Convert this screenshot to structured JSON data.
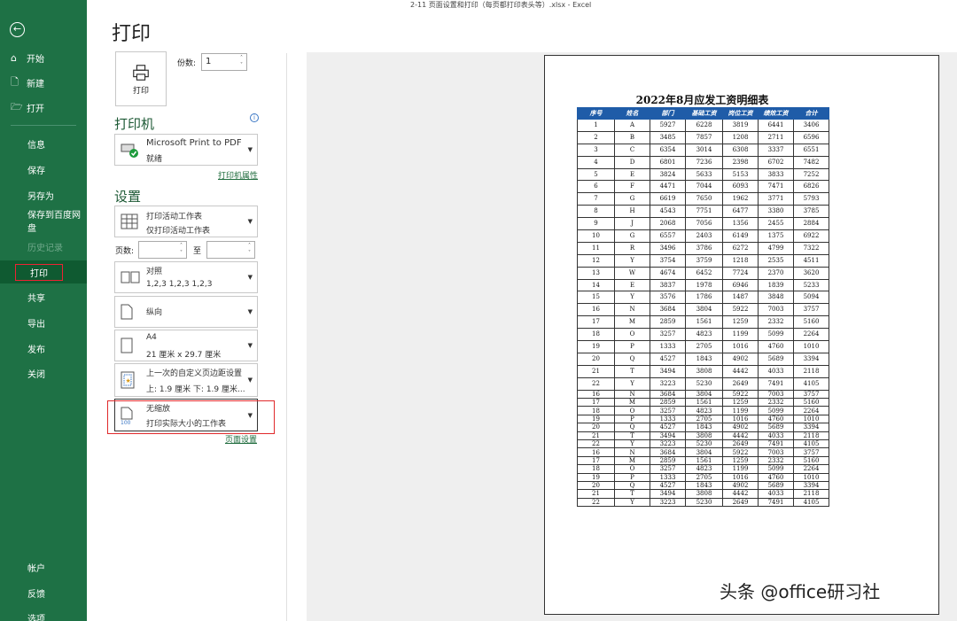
{
  "window_title": "2-11 页面设置和打印（每页都打印表头等）.xlsx  -  Excel",
  "page_title": "打印",
  "sidebar": {
    "top": [
      {
        "label": "开始",
        "icon": "⌂"
      },
      {
        "label": "新建",
        "icon": "🗋"
      },
      {
        "label": "打开",
        "icon": "🗁"
      }
    ],
    "main": [
      {
        "label": "信息"
      },
      {
        "label": "保存"
      },
      {
        "label": "另存为"
      },
      {
        "label": "保存到百度网盘"
      },
      {
        "label": "历史记录"
      },
      {
        "label": "打印"
      },
      {
        "label": "共享"
      },
      {
        "label": "导出"
      },
      {
        "label": "发布"
      },
      {
        "label": "关闭"
      }
    ],
    "bottom": [
      {
        "label": "帐户"
      },
      {
        "label": "反馈"
      },
      {
        "label": "选项"
      }
    ]
  },
  "print": {
    "button_label": "打印",
    "copies_label": "份数:",
    "copies_value": "1",
    "printer_heading": "打印机",
    "printer_name": "Microsoft Print to PDF",
    "printer_status": "就绪",
    "printer_props_link": "打印机属性",
    "settings_heading": "设置",
    "scope_line1": "打印活动工作表",
    "scope_line2": "仅打印活动工作表",
    "pages_label": "页数:",
    "pages_to": "至",
    "collate_line1": "对照",
    "collate_line2": "1,2,3    1,2,3    1,2,3",
    "orientation": "纵向",
    "paper_line1": "A4",
    "paper_line2": "21 厘米 x 29.7 厘米",
    "margins_line1": "上一次的自定义页边距设置",
    "margins_line2": "上: 1.9 厘米 下: 1.9 厘米...",
    "scaling_line1": "无缩放",
    "scaling_line2": "打印实际大小的工作表",
    "page_setup_link": "页面设置"
  },
  "sheet": {
    "title": "2022年8月应发工资明细表",
    "headers": [
      "序号",
      "姓名",
      "部门",
      "基础工资",
      "岗位工资",
      "绩效工资",
      "合计"
    ],
    "rows": [
      [
        "1",
        "A",
        "5927",
        "6228",
        "3819",
        "6441",
        "3406"
      ],
      [
        "2",
        "B",
        "3485",
        "7857",
        "1208",
        "2711",
        "6596"
      ],
      [
        "3",
        "C",
        "6354",
        "3014",
        "6308",
        "3337",
        "6551"
      ],
      [
        "4",
        "D",
        "6801",
        "7236",
        "2398",
        "6702",
        "7482"
      ],
      [
        "5",
        "E",
        "3824",
        "5633",
        "5153",
        "3833",
        "7252"
      ],
      [
        "6",
        "F",
        "4471",
        "7044",
        "6093",
        "7471",
        "6826"
      ],
      [
        "7",
        "G",
        "6619",
        "7650",
        "1962",
        "3771",
        "5793"
      ],
      [
        "8",
        "H",
        "4543",
        "7751",
        "6477",
        "3380",
        "3785"
      ],
      [
        "9",
        "J",
        "2068",
        "7056",
        "1356",
        "2455",
        "2884"
      ],
      [
        "10",
        "G",
        "6557",
        "2403",
        "6149",
        "1375",
        "6922"
      ],
      [
        "11",
        "R",
        "3496",
        "3786",
        "6272",
        "4799",
        "7322"
      ],
      [
        "12",
        "Y",
        "3754",
        "3759",
        "1218",
        "2535",
        "4511"
      ],
      [
        "13",
        "W",
        "4674",
        "6452",
        "7724",
        "2370",
        "3620"
      ],
      [
        "14",
        "E",
        "3837",
        "1978",
        "6946",
        "1839",
        "5233"
      ],
      [
        "15",
        "Y",
        "3576",
        "1786",
        "1487",
        "3848",
        "5094"
      ],
      [
        "16",
        "N",
        "3684",
        "3804",
        "5922",
        "7003",
        "3757"
      ],
      [
        "17",
        "M",
        "2859",
        "1561",
        "1259",
        "2332",
        "5160"
      ],
      [
        "18",
        "O",
        "3257",
        "4823",
        "1199",
        "5099",
        "2264"
      ],
      [
        "19",
        "P",
        "1333",
        "2705",
        "1016",
        "4760",
        "1010"
      ],
      [
        "20",
        "Q",
        "4527",
        "1843",
        "4902",
        "5689",
        "3394"
      ],
      [
        "21",
        "T",
        "3494",
        "3808",
        "4442",
        "4033",
        "2118"
      ],
      [
        "22",
        "Y",
        "3223",
        "5230",
        "2649",
        "7491",
        "4105"
      ],
      [
        "16",
        "N",
        "3684",
        "3804",
        "5922",
        "7003",
        "3757"
      ],
      [
        "17",
        "M",
        "2859",
        "1561",
        "1259",
        "2332",
        "5160"
      ],
      [
        "18",
        "O",
        "3257",
        "4823",
        "1199",
        "5099",
        "2264"
      ],
      [
        "19",
        "P",
        "1333",
        "2705",
        "1016",
        "4760",
        "1010"
      ],
      [
        "20",
        "Q",
        "4527",
        "1843",
        "4902",
        "5689",
        "3394"
      ],
      [
        "21",
        "T",
        "3494",
        "3808",
        "4442",
        "4033",
        "2118"
      ],
      [
        "22",
        "Y",
        "3223",
        "5230",
        "2649",
        "7491",
        "4105"
      ],
      [
        "16",
        "N",
        "3684",
        "3804",
        "5922",
        "7003",
        "3757"
      ],
      [
        "17",
        "M",
        "2859",
        "1561",
        "1259",
        "2332",
        "5160"
      ],
      [
        "18",
        "O",
        "3257",
        "4823",
        "1199",
        "5099",
        "2264"
      ],
      [
        "19",
        "P",
        "1333",
        "2705",
        "1016",
        "4760",
        "1010"
      ],
      [
        "20",
        "Q",
        "4527",
        "1843",
        "4902",
        "5689",
        "3394"
      ],
      [
        "21",
        "T",
        "3494",
        "3808",
        "4442",
        "4033",
        "2118"
      ],
      [
        "22",
        "Y",
        "3223",
        "5230",
        "2649",
        "7491",
        "4105"
      ]
    ]
  },
  "watermark": "头条 @office研习社",
  "colors": {
    "sidebar": "#1e7145",
    "header_fill": "#1f5ca8",
    "highlight": "#e0292b"
  }
}
